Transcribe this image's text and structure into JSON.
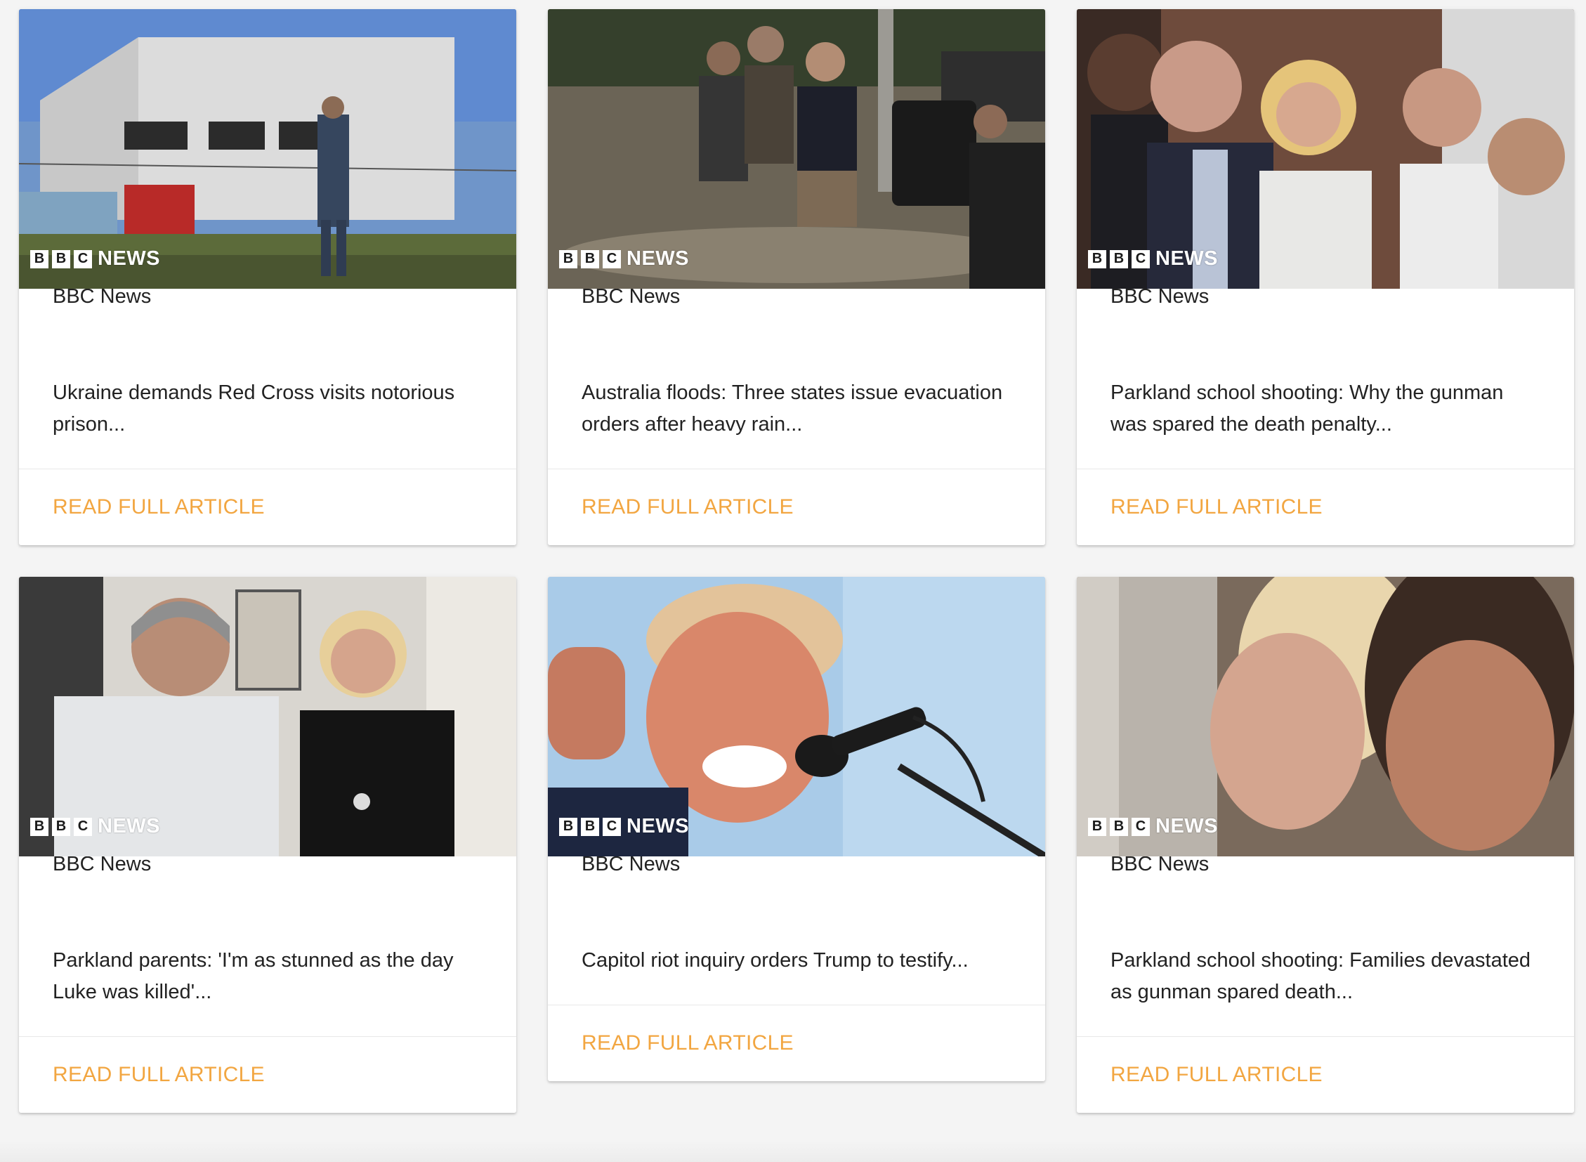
{
  "brand": {
    "logo_blocks": [
      "B",
      "B",
      "C"
    ],
    "logo_word": "NEWS",
    "accent_color": "#f2a641"
  },
  "cards": [
    {
      "source": "BBC News",
      "headline": "Ukraine demands Red Cross visits notorious prison...",
      "action_label": "READ FULL ARTICLE"
    },
    {
      "source": "BBC News",
      "headline": "Australia floods: Three states issue evacuation orders after heavy rain...",
      "action_label": "READ FULL ARTICLE"
    },
    {
      "source": "BBC News",
      "headline": "Parkland school shooting: Why the gunman was spared the death penalty...",
      "action_label": "READ FULL ARTICLE"
    },
    {
      "source": "BBC News",
      "headline": "Parkland parents: 'I'm as stunned as the day Luke was killed'...",
      "action_label": "READ FULL ARTICLE"
    },
    {
      "source": "BBC News",
      "headline": "Capitol riot inquiry orders Trump to testify...",
      "action_label": "READ FULL ARTICLE"
    },
    {
      "source": "BBC News",
      "headline": "Parkland school shooting: Families devastated as gunman spared death...",
      "action_label": "READ FULL ARTICLE"
    }
  ]
}
